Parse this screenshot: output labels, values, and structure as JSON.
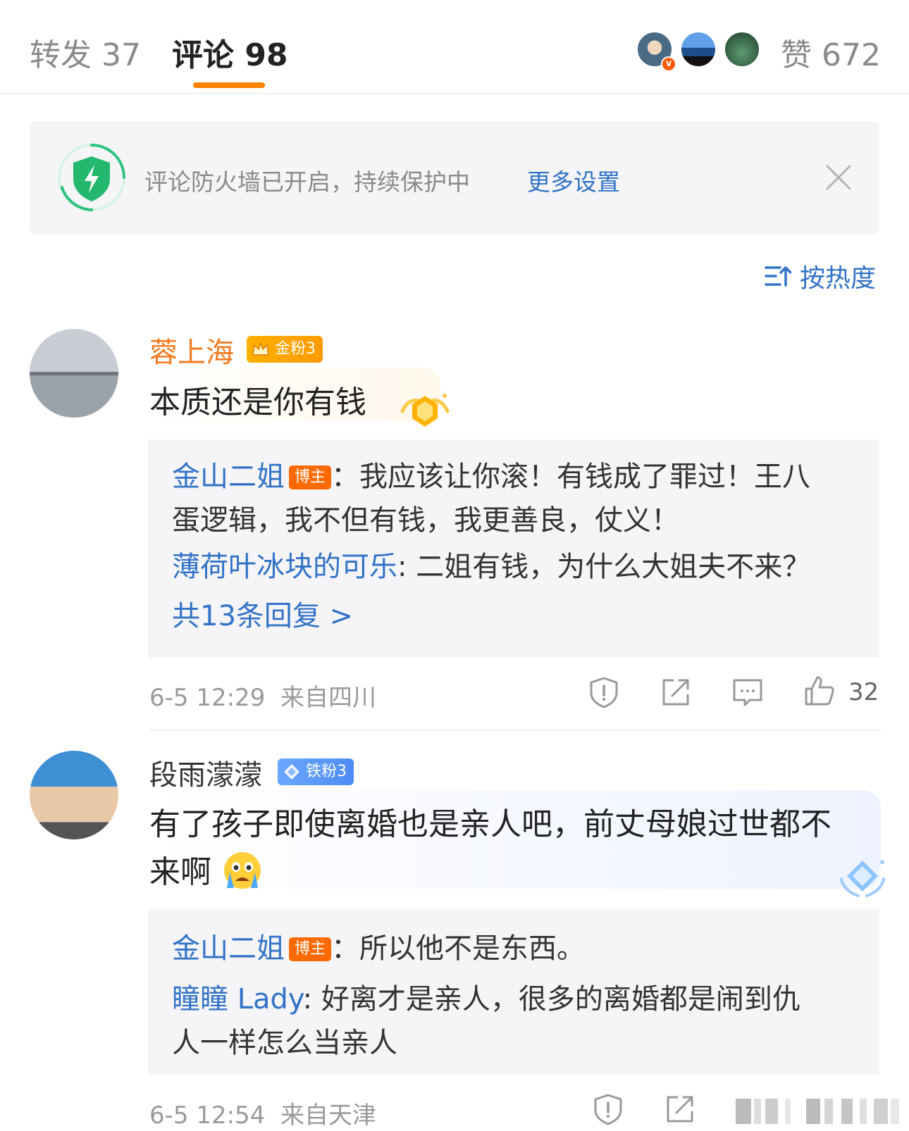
{
  "tabs": {
    "repost": "转发 37",
    "comments": "评论 98",
    "likes": "赞 672"
  },
  "colors": {
    "accent": "#ff8200",
    "link": "#3273c7",
    "username_hot": "#f47a20",
    "host_badge": "#ff6a00"
  },
  "firewall": {
    "text": "评论防火墙已开启，持续保护中",
    "link": "更多设置",
    "icon": "shield-bolt-icon",
    "close_icon": "close-icon"
  },
  "sort": {
    "label": "按热度",
    "icon": "sort-icon"
  },
  "comments": [
    {
      "username": "蓉上海",
      "badge": "金粉3",
      "text": "本质还是你有钱",
      "replies": [
        {
          "user": "金山二姐",
          "badge": "博主",
          "text_line1": "：我应该让你滚！有钱成了罪过！王八",
          "text_line2": "蛋逻辑，我不但有钱，我更善良，仗义！"
        },
        {
          "user": "薄荷叶冰块的可乐",
          "text": ": 二姐有钱，为什么大姐夫不来？"
        }
      ],
      "more_replies": "共13条回复 >",
      "time": "6-5 12:29",
      "location": "来自四川",
      "like_count": "32"
    },
    {
      "username": "段雨濛濛",
      "badge": "铁粉3",
      "text_line1": "有了孩子即使离婚也是亲人吧，前丈母娘过世都不",
      "text_line2": "来啊",
      "emoji": "crying-face-emoji",
      "replies": [
        {
          "user": "金山二姐",
          "badge": "博主",
          "text": "：所以他不是东西。"
        },
        {
          "user": "瞳瞳 Lady",
          "text_line1": ": 好离才是亲人，很多的离婚都是闹到仇",
          "text_line2": "人一样怎么当亲人"
        }
      ],
      "time": "6-5 12:54",
      "location": "来自天津"
    }
  ]
}
